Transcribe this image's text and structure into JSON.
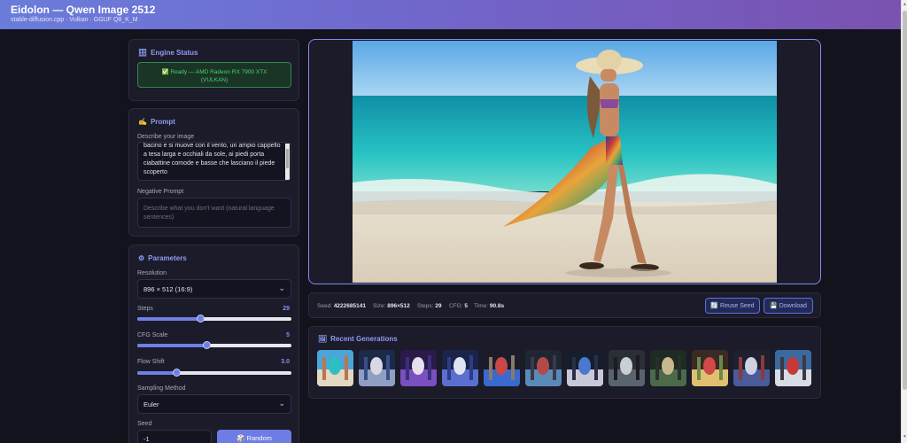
{
  "header": {
    "title": "Eidolon — Qwen Image 2512",
    "subtitle": "stable-diffusion.cpp · Vulkan · GGUF Q8_K_M"
  },
  "engine_status": {
    "icon": "database-icon",
    "title": "Engine Status",
    "status_line1": "✅ Ready — AMD Radeon RX 7900 XTX",
    "status_line2": "(VULKAN)",
    "status_color": "#4cd070"
  },
  "prompt": {
    "icon": "writing-hand-icon",
    "title": "Prompt",
    "describe_label": "Describe your image",
    "prompt_value": "bacino e si muove con il vento, un ampio cappello a tesa larga e occhiali da sole, ai piedi porta ciabattine comode e basse che lasciano il piede scoperto",
    "negative_label": "Negative Prompt",
    "negative_placeholder": "Describe what you don't want (natural language sentences)",
    "negative_value": ""
  },
  "parameters": {
    "icon": "gear-icon",
    "title": "Parameters",
    "resolution_label": "Resolution",
    "resolution_value": "896 × 512 (16:9)",
    "steps_label": "Steps",
    "steps_value": "29",
    "steps_fraction": 0.41,
    "cfg_label": "CFG Scale",
    "cfg_value": "5",
    "cfg_fraction": 0.45,
    "flow_label": "Flow Shift",
    "flow_value": "3.0",
    "flow_fraction": 0.25,
    "sampling_label": "Sampling Method",
    "sampling_value": "Euler",
    "seed_label": "Seed",
    "seed_value": "-1",
    "random_label": "🎲 Random"
  },
  "result": {
    "seed_label": "Seed:",
    "seed_value": "4222685141",
    "size_label": "Size:",
    "size_value": "896×512",
    "steps_label": "Steps:",
    "steps_value": "29",
    "cfg_label": "CFG:",
    "cfg_value": "5",
    "time_label": "Time:",
    "time_value": "90.8s",
    "reuse_label": "🔄 Reuse Seed",
    "download_label": "💾 Download"
  },
  "recent": {
    "icon": "image-icon",
    "title": "Recent Generations",
    "thumbnails": [
      "beach-woman",
      "old-wizard",
      "old-wizard-purple",
      "old-wizard-blue",
      "neon-street",
      "city-rain",
      "city-rain-blue",
      "mountain-road",
      "forest-monks",
      "parade-crowd",
      "festival-crowd",
      "coast-cars"
    ]
  },
  "colors": {
    "accent": "#7f8ff0",
    "header_start": "#6a7ddb",
    "header_end": "#7a52b0",
    "background": "#13131d",
    "panel": "#1b1b29"
  }
}
